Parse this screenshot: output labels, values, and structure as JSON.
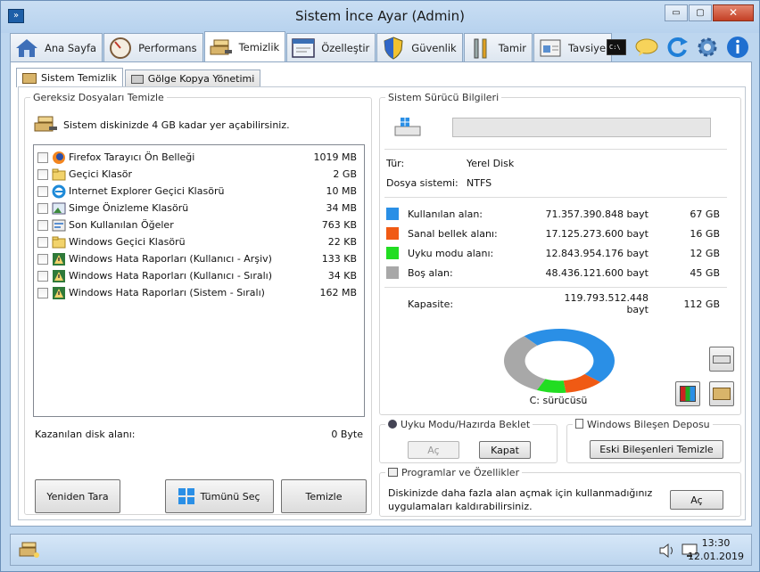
{
  "window": {
    "title": "Sistem İnce Ayar (Admin)",
    "minimize": "▭",
    "maximize": "▢",
    "close": "✕"
  },
  "tabs": [
    {
      "label": "Ana Sayfa",
      "icon": "house-icon"
    },
    {
      "label": "Performans",
      "icon": "speedometer-icon"
    },
    {
      "label": "Temizlik",
      "icon": "broom-icon",
      "active": true
    },
    {
      "label": "Özelleştir",
      "icon": "window-icon"
    },
    {
      "label": "Güvenlik",
      "icon": "shield-icon"
    },
    {
      "label": "Tamir",
      "icon": "wrench-icon"
    },
    {
      "label": "Tavsiye",
      "icon": "recommend-icon"
    }
  ],
  "subtabs": [
    "Sistem Temizlik",
    "Gölge Kopya Yönetimi"
  ],
  "cleanup": {
    "legend": "Gereksiz Dosyaları Temizle",
    "hint": "Sistem diskinizde 4 GB kadar yer açabilirsiniz.",
    "items": [
      {
        "name": "Firefox Tarayıcı Ön Belleği",
        "size": "1019 MB",
        "icon": "firefox-icon"
      },
      {
        "name": "Geçici Klasör",
        "size": "2 GB",
        "icon": "folder-icon"
      },
      {
        "name": "Internet Explorer Geçici Klasörü",
        "size": "10 MB",
        "icon": "ie-icon"
      },
      {
        "name": "Simge Önizleme Klasörü",
        "size": "34 MB",
        "icon": "thumbnail-icon"
      },
      {
        "name": "Son Kullanılan Öğeler",
        "size": "763 KB",
        "icon": "recent-icon"
      },
      {
        "name": "Windows Geçici Klasörü",
        "size": "22 KB",
        "icon": "folder-icon"
      },
      {
        "name": "Windows Hata Raporları (Kullanıcı - Arşiv)",
        "size": "133 KB",
        "icon": "error-report-icon"
      },
      {
        "name": "Windows Hata Raporları (Kullanıcı - Sıralı)",
        "size": "34 KB",
        "icon": "error-report-icon"
      },
      {
        "name": "Windows Hata Raporları (Sistem - Sıralı)",
        "size": "162 MB",
        "icon": "error-report-icon"
      }
    ],
    "gained_label": "Kazanılan disk alanı:",
    "gained_value": "0 Byte",
    "rescan": "Yeniden Tara",
    "select_all": "Tümünü Seç",
    "clean": "Temizle"
  },
  "drive": {
    "legend": "Sistem Sürücü Bilgileri",
    "type_label": "Tür:",
    "type_value": "Yerel Disk",
    "fs_label": "Dosya sistemi:",
    "fs_value": "NTFS",
    "stats": [
      {
        "label": "Kullanılan alan:",
        "bytes": "71.357.390.848 bayt",
        "gb": "67 GB",
        "color": "#2a8fe6"
      },
      {
        "label": "Sanal bellek alanı:",
        "bytes": "17.125.273.600 bayt",
        "gb": "16 GB",
        "color": "#f05a14"
      },
      {
        "label": "Uyku modu alanı:",
        "bytes": "12.843.954.176 bayt",
        "gb": "12 GB",
        "color": "#22dd22"
      },
      {
        "label": "Boş alan:",
        "bytes": "48.436.121.600 bayt",
        "gb": "45 GB",
        "color": "#a8a8a8"
      }
    ],
    "capacity_label": "Kapasite:",
    "capacity_bytes": "119.793.512.448 bayt",
    "capacity_gb": "112 GB",
    "drive_name": "C: sürücüsü"
  },
  "sleep": {
    "legend": "Uyku Modu/Hazırda Beklet",
    "on": "Aç",
    "off": "Kapat"
  },
  "components": {
    "legend": "Windows Bileşen Deposu",
    "button": "Eski Bileşenleri Temizle"
  },
  "programs": {
    "legend": "Programlar ve Özellikler",
    "text1": "Diskinizde daha fazla alan açmak için kullanmadığınız",
    "text2": "uygulamaları kaldırabilirsiniz.",
    "button": "Aç"
  },
  "clock": {
    "time": "13:30",
    "date": "12.01.2019"
  }
}
